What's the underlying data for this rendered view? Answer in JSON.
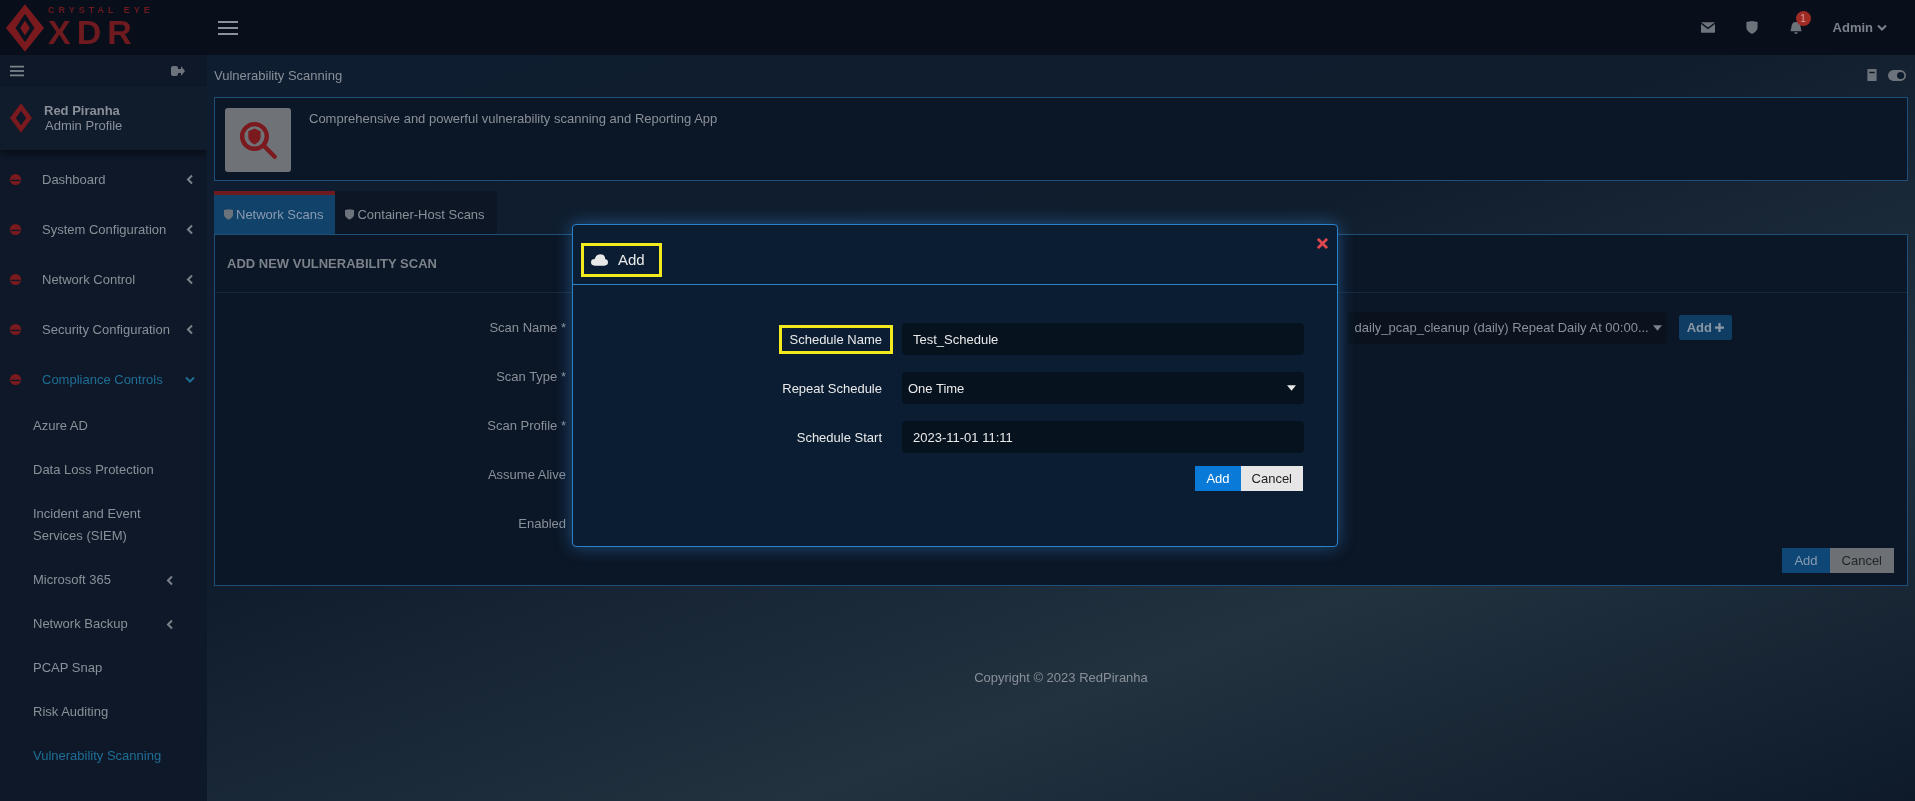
{
  "header": {
    "logo_tagline": "CRYSTAL EYE",
    "logo_text": "XDR",
    "notification_count": "1",
    "user": "Admin"
  },
  "sidebar": {
    "profile": {
      "name": "Red Piranha",
      "role": "Admin Profile"
    },
    "items": [
      {
        "label": "Dashboard",
        "kind": "menu",
        "expanded": false,
        "selected": false
      },
      {
        "label": "System Configuration",
        "kind": "menu",
        "expanded": false,
        "selected": false
      },
      {
        "label": "Network Control",
        "kind": "menu",
        "expanded": false,
        "selected": false
      },
      {
        "label": "Security Configuration",
        "kind": "menu",
        "expanded": false,
        "selected": false
      },
      {
        "label": "Compliance Controls",
        "kind": "menu",
        "expanded": true,
        "selected": true,
        "children": [
          {
            "label": "Azure AD",
            "kind": "link",
            "selected": false
          },
          {
            "label": "Data Loss Protection",
            "kind": "link",
            "selected": false
          },
          {
            "label": "Incident and Event Services (SIEM)",
            "kind": "link",
            "selected": false
          },
          {
            "label": "Microsoft 365",
            "kind": "menu",
            "expanded": false,
            "selected": false
          },
          {
            "label": "Network Backup",
            "kind": "menu",
            "expanded": false,
            "selected": false
          },
          {
            "label": "PCAP Snap",
            "kind": "link",
            "selected": false
          },
          {
            "label": "Risk Auditing",
            "kind": "link",
            "selected": false
          },
          {
            "label": "Vulnerability Scanning",
            "kind": "link",
            "selected": true
          }
        ]
      }
    ]
  },
  "page": {
    "title": "Vulnerability Scanning",
    "app_description": "Comprehensive and powerful vulnerability scanning and Reporting App",
    "tabs": [
      {
        "label": "Network Scans",
        "selected": true
      },
      {
        "label": "Container-Host Scans",
        "selected": false
      }
    ],
    "form": {
      "title": "ADD NEW VULNERABILITY SCAN",
      "fields": [
        "Scan Name *",
        "Scan Type *",
        "Scan Profile *",
        "Assume Alive",
        "Enabled"
      ],
      "schedule_value": "daily_pcap_cleanup (daily) Repeat Daily At 00:00...",
      "add_schedule_button": "Add",
      "buttons": [
        "Add",
        "Cancel"
      ]
    },
    "footer": "Copyright © 2023 RedPiranha"
  },
  "modal": {
    "title": "Add",
    "title_highlighted": true,
    "fields": [
      {
        "label": "Schedule Name",
        "value": "Test_Schedule",
        "kind": "text",
        "highlighted": true
      },
      {
        "label": "Repeat Schedule",
        "value": "One Time",
        "kind": "select",
        "highlighted": false
      },
      {
        "label": "Schedule Start",
        "value": "2023-11-01 11:11",
        "kind": "text",
        "highlighted": false
      }
    ],
    "buttons": [
      "Add",
      "Cancel"
    ]
  }
}
